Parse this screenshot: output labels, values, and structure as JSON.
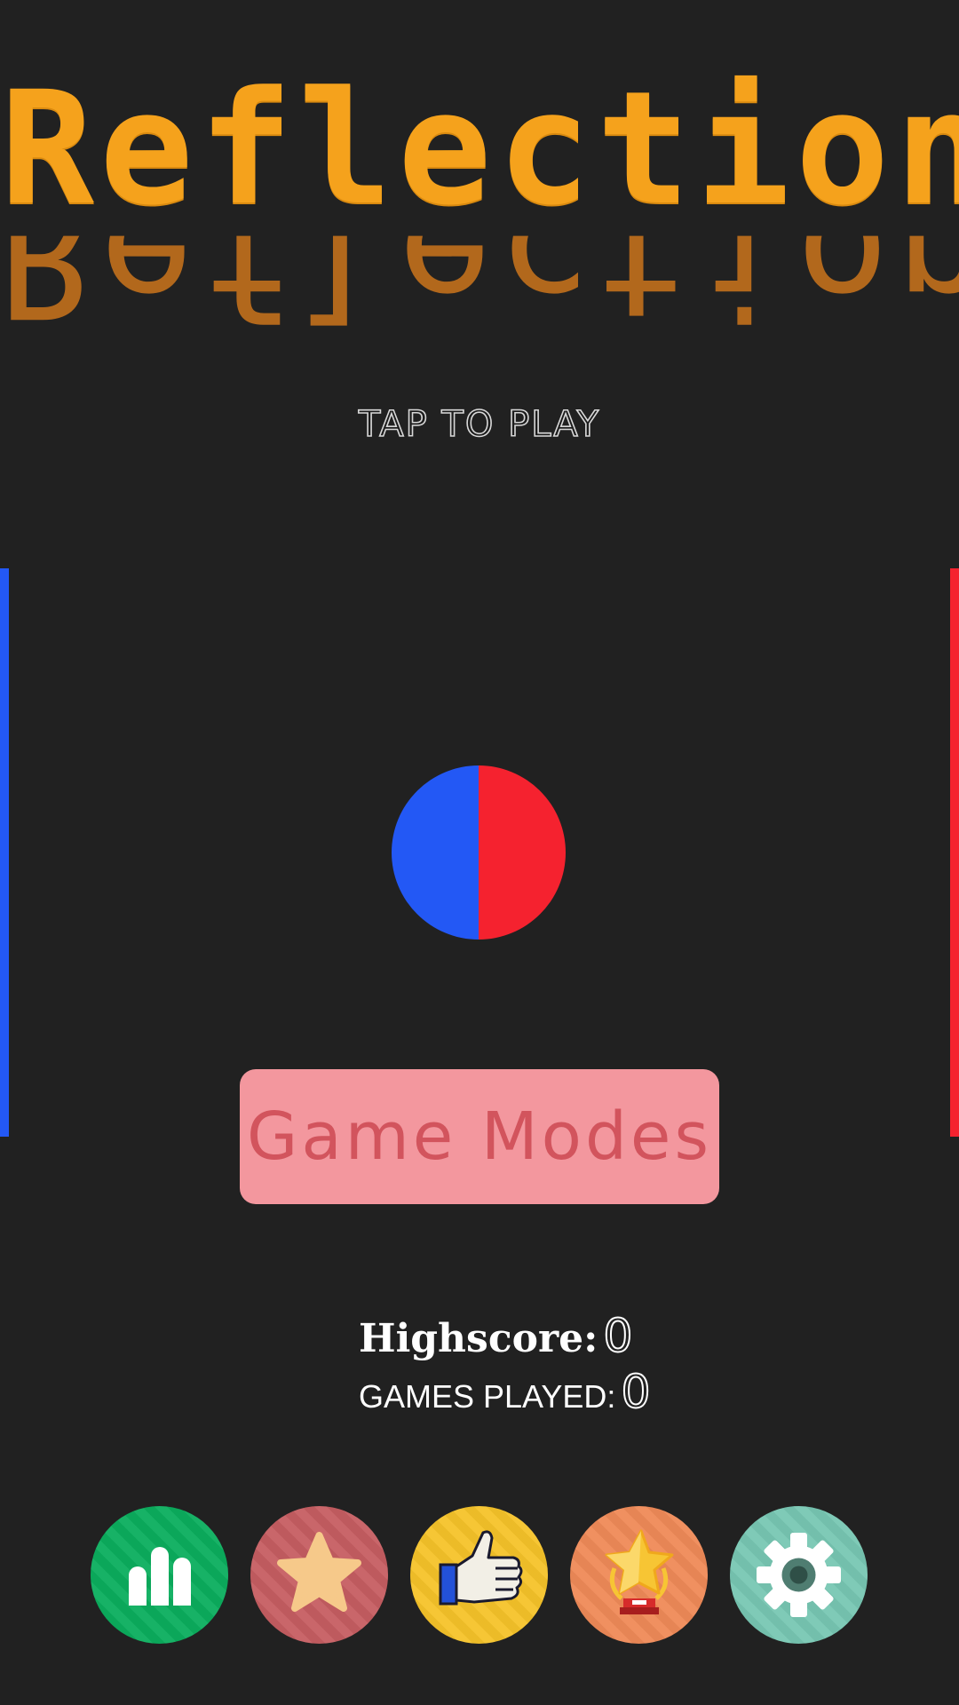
{
  "title": "Reflection",
  "tap_to_play": "TAP TO PLAY",
  "game_modes_label": "Game Modes",
  "stats": {
    "highscore_label": "Highscore:",
    "highscore_value": "0",
    "games_played_label": "GAMES PLAYED:",
    "games_played_value": "0"
  },
  "bottom_bar": [
    {
      "icon": "leaderboard-icon",
      "color": "#0bae5e"
    },
    {
      "icon": "star-icon",
      "color": "#c65e62"
    },
    {
      "icon": "thumbs-up-icon",
      "color": "#f6c32a"
    },
    {
      "icon": "trophy-icon",
      "color": "#ef8a58"
    },
    {
      "icon": "gear-icon",
      "color": "#78c7b3"
    }
  ],
  "colors": {
    "background": "#212121",
    "title": "#f5a21c",
    "title_reflection": "#b2681c",
    "blue": "#2358f5",
    "red": "#f5222f",
    "button_bg": "#f3979e",
    "button_text": "#d2545d"
  }
}
